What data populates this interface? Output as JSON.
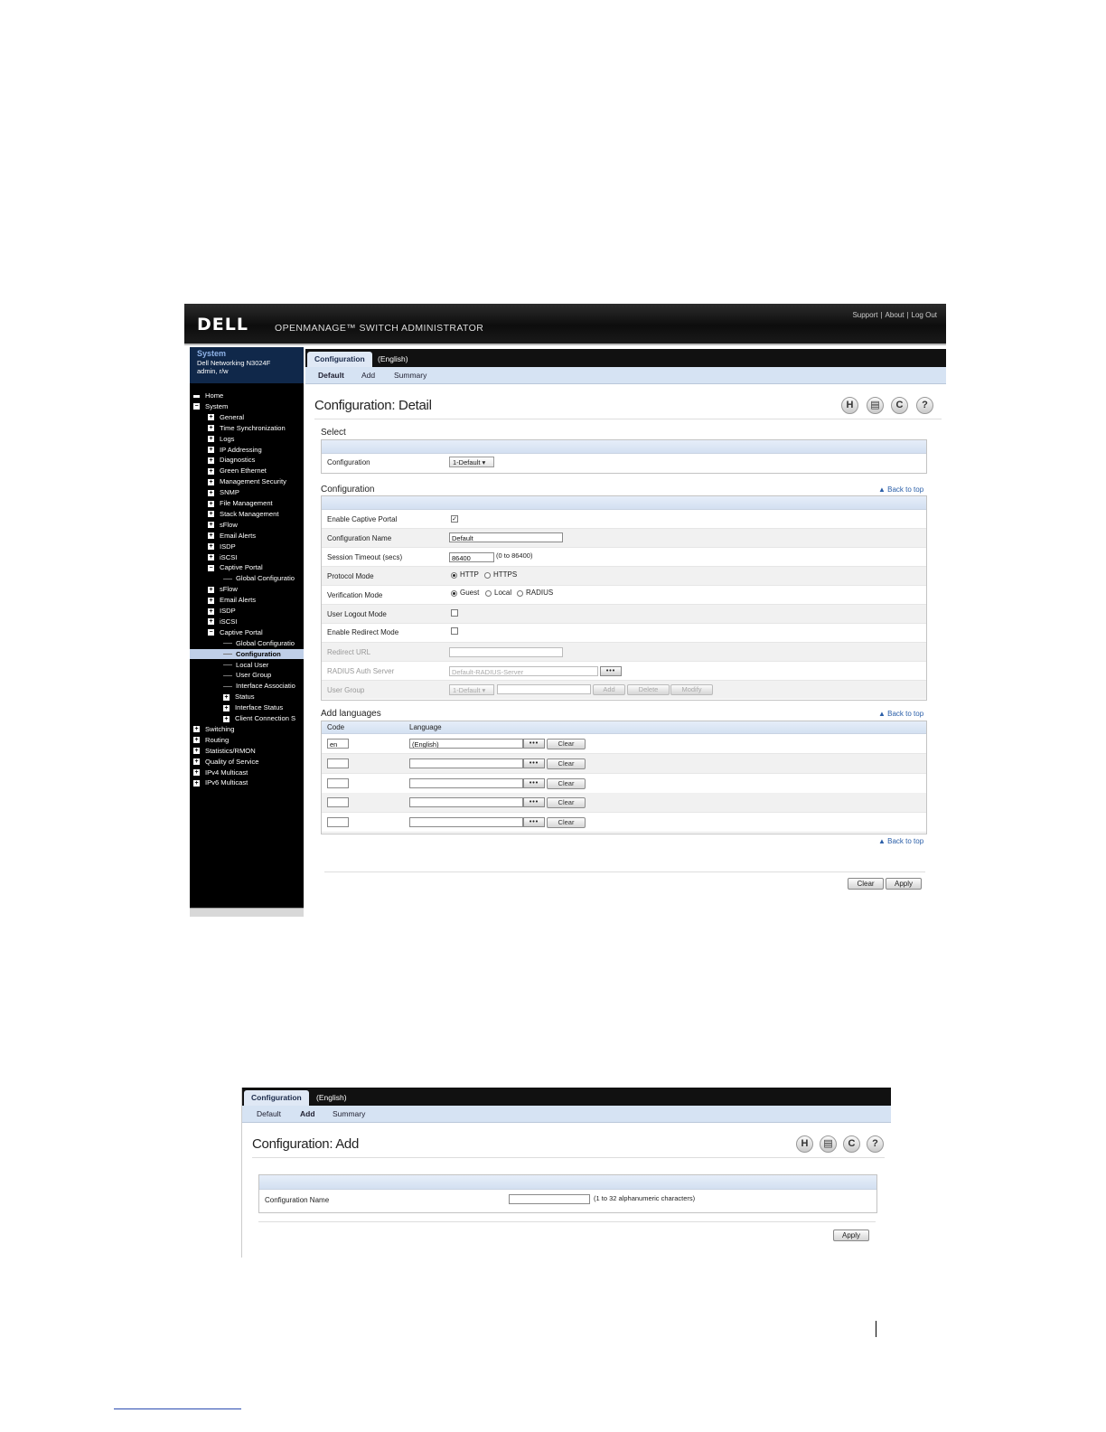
{
  "shot1": {
    "brand": {
      "logo": "DELL",
      "app_title": "OPENMANAGE™ SWITCH ADMINISTRATOR",
      "links": [
        "Support",
        "About",
        "Log Out"
      ],
      "link_separator": "|"
    },
    "system": {
      "title": "System",
      "device": "Dell Networking N3024F",
      "user": "admin, r/w"
    },
    "tree": [
      {
        "label": "Home",
        "level": 0,
        "icon": "home-icon"
      },
      {
        "label": "System",
        "level": 0,
        "icon": "minus"
      },
      {
        "label": "General",
        "level": 1,
        "icon": "plus"
      },
      {
        "label": "Time Synchronization",
        "level": 1,
        "icon": "plus"
      },
      {
        "label": "Logs",
        "level": 1,
        "icon": "plus"
      },
      {
        "label": "IP Addressing",
        "level": 1,
        "icon": "plus"
      },
      {
        "label": "Diagnostics",
        "level": 1,
        "icon": "plus"
      },
      {
        "label": "Green Ethernet",
        "level": 1,
        "icon": "plus"
      },
      {
        "label": "Management Security",
        "level": 1,
        "icon": "plus"
      },
      {
        "label": "SNMP",
        "level": 1,
        "icon": "plus"
      },
      {
        "label": "File Management",
        "level": 1,
        "icon": "plus"
      },
      {
        "label": "Stack Management",
        "level": 1,
        "icon": "plus"
      },
      {
        "label": "sFlow",
        "level": 1,
        "icon": "plus"
      },
      {
        "label": "Email Alerts",
        "level": 1,
        "icon": "plus"
      },
      {
        "label": "ISDP",
        "level": 1,
        "icon": "plus"
      },
      {
        "label": "iSCSI",
        "level": 1,
        "icon": "plus"
      },
      {
        "label": "Captive Portal",
        "level": 1,
        "icon": "minus"
      },
      {
        "label": "Global Configuratio",
        "level": 2,
        "icon": "dash"
      },
      {
        "label": "sFlow",
        "level": 1,
        "icon": "plus"
      },
      {
        "label": "Email Alerts",
        "level": 1,
        "icon": "plus"
      },
      {
        "label": "ISDP",
        "level": 1,
        "icon": "plus"
      },
      {
        "label": "iSCSI",
        "level": 1,
        "icon": "plus"
      },
      {
        "label": "Captive Portal",
        "level": 1,
        "icon": "minus"
      },
      {
        "label": "Global Configuratio",
        "level": 2,
        "icon": "dash"
      },
      {
        "label": "Configuration",
        "level": 2,
        "icon": "dash",
        "selected": true
      },
      {
        "label": "Local User",
        "level": 2,
        "icon": "dash"
      },
      {
        "label": "User Group",
        "level": 2,
        "icon": "dash"
      },
      {
        "label": "Interface Associatio",
        "level": 2,
        "icon": "dash"
      },
      {
        "label": "Status",
        "level": 2,
        "icon": "plus"
      },
      {
        "label": "Interface Status",
        "level": 2,
        "icon": "plus"
      },
      {
        "label": "Client Connection S",
        "level": 2,
        "icon": "plus"
      },
      {
        "label": "Switching",
        "level": 0,
        "icon": "plus"
      },
      {
        "label": "Routing",
        "level": 0,
        "icon": "plus"
      },
      {
        "label": "Statistics/RMON",
        "level": 0,
        "icon": "plus"
      },
      {
        "label": "Quality of Service",
        "level": 0,
        "icon": "plus"
      },
      {
        "label": "IPv4 Multicast",
        "level": 0,
        "icon": "plus"
      },
      {
        "label": "IPv6 Multicast",
        "level": 0,
        "icon": "plus"
      }
    ],
    "tabs": [
      "Configuration",
      "(English)"
    ],
    "subtabs": [
      "Default",
      "Add",
      "Summary"
    ],
    "page_title": "Configuration: Detail",
    "toolbar_icons": [
      "save-icon",
      "print-icon",
      "refresh-icon",
      "help-icon"
    ],
    "select_section": {
      "title": "Select",
      "label": "Configuration",
      "value": "1-Default"
    },
    "config_section": {
      "title": "Configuration",
      "back_to_top": "Back to top",
      "enable_captive_portal": {
        "label": "Enable Captive Portal",
        "checked": true
      },
      "configuration_name": {
        "label": "Configuration Name",
        "value": "Default"
      },
      "session_timeout": {
        "label": "Session Timeout (secs)",
        "value": "86400",
        "hint": "(0 to 86400)"
      },
      "protocol_mode": {
        "label": "Protocol Mode",
        "options": [
          "HTTP",
          "HTTPS"
        ],
        "selected": "HTTP"
      },
      "verification_mode": {
        "label": "Verification Mode",
        "options": [
          "Guest",
          "Local",
          "RADIUS"
        ],
        "selected": "Guest"
      },
      "user_logout_mode": {
        "label": "User Logout Mode",
        "checked": false
      },
      "enable_redirect_mode": {
        "label": "Enable Redirect Mode",
        "checked": false
      },
      "redirect_url": {
        "label": "Redirect URL",
        "value": ""
      },
      "radius_auth_server": {
        "label": "RADIUS Auth Server",
        "value": "Default-RADIUS-Server"
      },
      "user_group": {
        "label": "User Group",
        "select": "1-Default",
        "buttons": [
          "Add",
          "Delete",
          "Modify"
        ]
      },
      "dots_label": "•••"
    },
    "languages_section": {
      "title": "Add languages",
      "back_to_top": "Back to top",
      "headers": [
        "Code",
        "Language"
      ],
      "rows": [
        {
          "code": "en",
          "language": "(English)"
        },
        {
          "code": "",
          "language": ""
        },
        {
          "code": "",
          "language": ""
        },
        {
          "code": "",
          "language": ""
        },
        {
          "code": "",
          "language": ""
        }
      ],
      "clear_label": "Clear",
      "dots_label": "•••"
    },
    "bottom_back_to_top": "Back to top",
    "footer_buttons": [
      "Clear",
      "Apply"
    ]
  },
  "shot2": {
    "tabs": [
      "Configuration",
      "(English)"
    ],
    "subtabs": [
      "Default",
      "Add",
      "Summary"
    ],
    "active_subtab": "Add",
    "page_title": "Configuration: Add",
    "toolbar_icons": [
      "save-icon",
      "print-icon",
      "refresh-icon",
      "help-icon"
    ],
    "field": {
      "label": "Configuration Name",
      "value": "",
      "hint": "(1 to 32 alphanumeric characters)"
    },
    "apply_label": "Apply"
  }
}
